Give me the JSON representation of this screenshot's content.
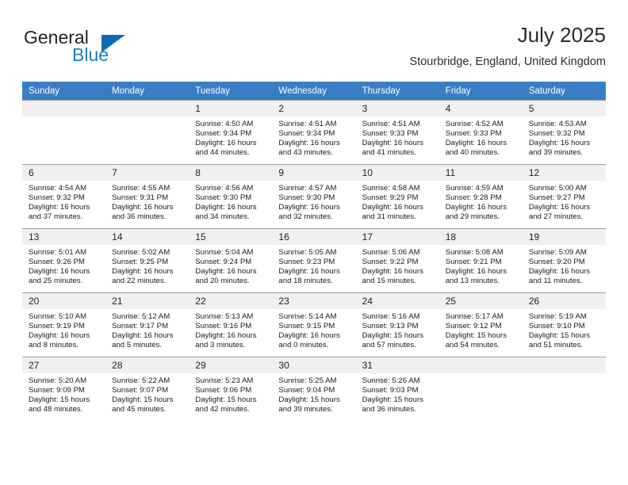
{
  "logo": {
    "text_primary": "General",
    "text_secondary": "Blue",
    "triangle_color": "#0d6cb1",
    "secondary_color": "#1e7bc4"
  },
  "header": {
    "title": "July 2025",
    "subtitle": "Stourbridge, England, United Kingdom"
  },
  "theme": {
    "header_row_bg": "#3b7dc4",
    "day_number_bg": "#f0f0f0",
    "grid_line": "#9e9e9e"
  },
  "weekday_headers": [
    "Sunday",
    "Monday",
    "Tuesday",
    "Wednesday",
    "Thursday",
    "Friday",
    "Saturday"
  ],
  "weeks": [
    [
      {
        "day": "",
        "blank": true,
        "sunrise": "",
        "sunset": "",
        "daylight1": "",
        "daylight2": ""
      },
      {
        "day": "",
        "blank": true,
        "sunrise": "",
        "sunset": "",
        "daylight1": "",
        "daylight2": ""
      },
      {
        "day": "1",
        "sunrise": "Sunrise: 4:50 AM",
        "sunset": "Sunset: 9:34 PM",
        "daylight1": "Daylight: 16 hours",
        "daylight2": "and 44 minutes."
      },
      {
        "day": "2",
        "sunrise": "Sunrise: 4:51 AM",
        "sunset": "Sunset: 9:34 PM",
        "daylight1": "Daylight: 16 hours",
        "daylight2": "and 43 minutes."
      },
      {
        "day": "3",
        "sunrise": "Sunrise: 4:51 AM",
        "sunset": "Sunset: 9:33 PM",
        "daylight1": "Daylight: 16 hours",
        "daylight2": "and 41 minutes."
      },
      {
        "day": "4",
        "sunrise": "Sunrise: 4:52 AM",
        "sunset": "Sunset: 9:33 PM",
        "daylight1": "Daylight: 16 hours",
        "daylight2": "and 40 minutes."
      },
      {
        "day": "5",
        "sunrise": "Sunrise: 4:53 AM",
        "sunset": "Sunset: 9:32 PM",
        "daylight1": "Daylight: 16 hours",
        "daylight2": "and 39 minutes."
      }
    ],
    [
      {
        "day": "6",
        "sunrise": "Sunrise: 4:54 AM",
        "sunset": "Sunset: 9:32 PM",
        "daylight1": "Daylight: 16 hours",
        "daylight2": "and 37 minutes."
      },
      {
        "day": "7",
        "sunrise": "Sunrise: 4:55 AM",
        "sunset": "Sunset: 9:31 PM",
        "daylight1": "Daylight: 16 hours",
        "daylight2": "and 36 minutes."
      },
      {
        "day": "8",
        "sunrise": "Sunrise: 4:56 AM",
        "sunset": "Sunset: 9:30 PM",
        "daylight1": "Daylight: 16 hours",
        "daylight2": "and 34 minutes."
      },
      {
        "day": "9",
        "sunrise": "Sunrise: 4:57 AM",
        "sunset": "Sunset: 9:30 PM",
        "daylight1": "Daylight: 16 hours",
        "daylight2": "and 32 minutes."
      },
      {
        "day": "10",
        "sunrise": "Sunrise: 4:58 AM",
        "sunset": "Sunset: 9:29 PM",
        "daylight1": "Daylight: 16 hours",
        "daylight2": "and 31 minutes."
      },
      {
        "day": "11",
        "sunrise": "Sunrise: 4:59 AM",
        "sunset": "Sunset: 9:28 PM",
        "daylight1": "Daylight: 16 hours",
        "daylight2": "and 29 minutes."
      },
      {
        "day": "12",
        "sunrise": "Sunrise: 5:00 AM",
        "sunset": "Sunset: 9:27 PM",
        "daylight1": "Daylight: 16 hours",
        "daylight2": "and 27 minutes."
      }
    ],
    [
      {
        "day": "13",
        "sunrise": "Sunrise: 5:01 AM",
        "sunset": "Sunset: 9:26 PM",
        "daylight1": "Daylight: 16 hours",
        "daylight2": "and 25 minutes."
      },
      {
        "day": "14",
        "sunrise": "Sunrise: 5:02 AM",
        "sunset": "Sunset: 9:25 PM",
        "daylight1": "Daylight: 16 hours",
        "daylight2": "and 22 minutes."
      },
      {
        "day": "15",
        "sunrise": "Sunrise: 5:04 AM",
        "sunset": "Sunset: 9:24 PM",
        "daylight1": "Daylight: 16 hours",
        "daylight2": "and 20 minutes."
      },
      {
        "day": "16",
        "sunrise": "Sunrise: 5:05 AM",
        "sunset": "Sunset: 9:23 PM",
        "daylight1": "Daylight: 16 hours",
        "daylight2": "and 18 minutes."
      },
      {
        "day": "17",
        "sunrise": "Sunrise: 5:06 AM",
        "sunset": "Sunset: 9:22 PM",
        "daylight1": "Daylight: 16 hours",
        "daylight2": "and 15 minutes."
      },
      {
        "day": "18",
        "sunrise": "Sunrise: 5:08 AM",
        "sunset": "Sunset: 9:21 PM",
        "daylight1": "Daylight: 16 hours",
        "daylight2": "and 13 minutes."
      },
      {
        "day": "19",
        "sunrise": "Sunrise: 5:09 AM",
        "sunset": "Sunset: 9:20 PM",
        "daylight1": "Daylight: 16 hours",
        "daylight2": "and 11 minutes."
      }
    ],
    [
      {
        "day": "20",
        "sunrise": "Sunrise: 5:10 AM",
        "sunset": "Sunset: 9:19 PM",
        "daylight1": "Daylight: 16 hours",
        "daylight2": "and 8 minutes."
      },
      {
        "day": "21",
        "sunrise": "Sunrise: 5:12 AM",
        "sunset": "Sunset: 9:17 PM",
        "daylight1": "Daylight: 16 hours",
        "daylight2": "and 5 minutes."
      },
      {
        "day": "22",
        "sunrise": "Sunrise: 5:13 AM",
        "sunset": "Sunset: 9:16 PM",
        "daylight1": "Daylight: 16 hours",
        "daylight2": "and 3 minutes."
      },
      {
        "day": "23",
        "sunrise": "Sunrise: 5:14 AM",
        "sunset": "Sunset: 9:15 PM",
        "daylight1": "Daylight: 16 hours",
        "daylight2": "and 0 minutes."
      },
      {
        "day": "24",
        "sunrise": "Sunrise: 5:16 AM",
        "sunset": "Sunset: 9:13 PM",
        "daylight1": "Daylight: 15 hours",
        "daylight2": "and 57 minutes."
      },
      {
        "day": "25",
        "sunrise": "Sunrise: 5:17 AM",
        "sunset": "Sunset: 9:12 PM",
        "daylight1": "Daylight: 15 hours",
        "daylight2": "and 54 minutes."
      },
      {
        "day": "26",
        "sunrise": "Sunrise: 5:19 AM",
        "sunset": "Sunset: 9:10 PM",
        "daylight1": "Daylight: 15 hours",
        "daylight2": "and 51 minutes."
      }
    ],
    [
      {
        "day": "27",
        "sunrise": "Sunrise: 5:20 AM",
        "sunset": "Sunset: 9:09 PM",
        "daylight1": "Daylight: 15 hours",
        "daylight2": "and 48 minutes."
      },
      {
        "day": "28",
        "sunrise": "Sunrise: 5:22 AM",
        "sunset": "Sunset: 9:07 PM",
        "daylight1": "Daylight: 15 hours",
        "daylight2": "and 45 minutes."
      },
      {
        "day": "29",
        "sunrise": "Sunrise: 5:23 AM",
        "sunset": "Sunset: 9:06 PM",
        "daylight1": "Daylight: 15 hours",
        "daylight2": "and 42 minutes."
      },
      {
        "day": "30",
        "sunrise": "Sunrise: 5:25 AM",
        "sunset": "Sunset: 9:04 PM",
        "daylight1": "Daylight: 15 hours",
        "daylight2": "and 39 minutes."
      },
      {
        "day": "31",
        "sunrise": "Sunrise: 5:26 AM",
        "sunset": "Sunset: 9:03 PM",
        "daylight1": "Daylight: 15 hours",
        "daylight2": "and 36 minutes."
      },
      {
        "day": "",
        "blank": true,
        "sunrise": "",
        "sunset": "",
        "daylight1": "",
        "daylight2": ""
      },
      {
        "day": "",
        "blank": true,
        "sunrise": "",
        "sunset": "",
        "daylight1": "",
        "daylight2": ""
      }
    ]
  ]
}
